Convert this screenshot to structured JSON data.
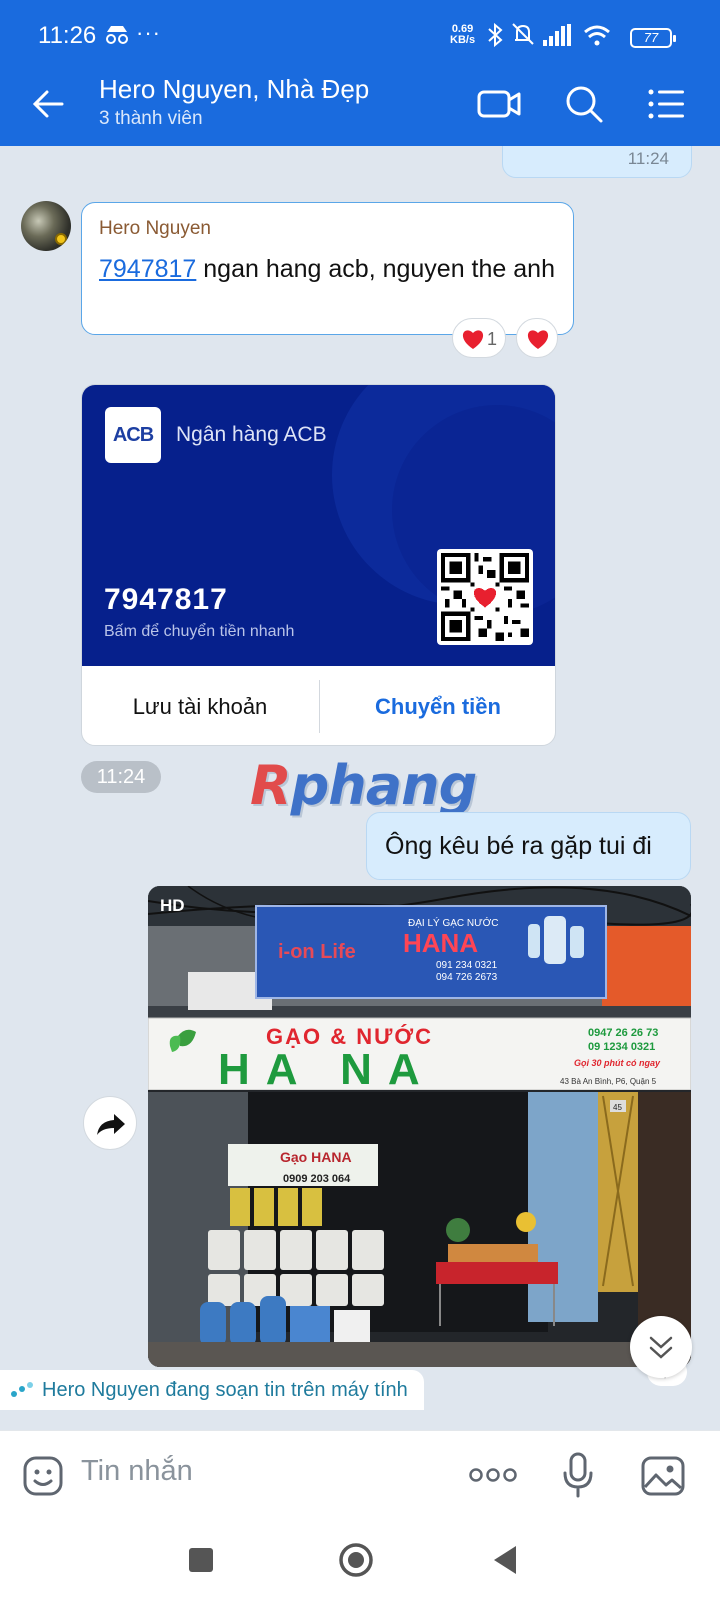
{
  "status_bar": {
    "time": "11:26",
    "more": "···",
    "net_speed_value": "0.69",
    "net_speed_unit": "KB/s",
    "battery": "77"
  },
  "header": {
    "title": "Hero Nguyen, Nhà Đẹp",
    "subtitle": "3 thành viên"
  },
  "chat": {
    "prev_outgoing_time": "11:24",
    "incoming_message": {
      "sender": "Hero Nguyen",
      "account_link": "7947817",
      "text": " ngan hang acb, nguyen the anh",
      "reaction_count": "1"
    },
    "bank_card": {
      "bank_logo": "ACB",
      "bank_name": "Ngân hàng ACB",
      "account_number": "7947817",
      "hint": "Bấm để chuyển tiền nhanh",
      "save_label": "Lưu tài khoản",
      "transfer_label": "Chuyển tiền"
    },
    "card_time": "11:24",
    "watermark_r": "R",
    "watermark_rest": "phang",
    "outgoing_message": "Ông kêu bé ra gặp tui đi",
    "photo": {
      "quality_badge": "HD",
      "banner_brand": "i-on Life",
      "banner_name": "HANA",
      "banner_agency": "ĐẠI LÝ GẠC NƯỚC",
      "banner_phone1": "091 234 0321",
      "banner_phone2": "094 726 2673",
      "sign_top": "GẠO & NƯỚC",
      "sign_main": "HA NA",
      "sign_phone1": "0947 26 26 73",
      "sign_phone2": "09 1234 0321",
      "sign_delivery": "Gọi 30 phút có ngay",
      "sign_address": "43 Bà An Bình, P6, Quận 5",
      "poster_title": "Gạo HANA",
      "poster_phone": "0909 203 064",
      "door_number": "45"
    },
    "typing_indicator": "Hero Nguyen đang soạn tin trên máy tính"
  },
  "composer": {
    "placeholder": "Tin nhắn"
  },
  "colors": {
    "header_blue": "#1a6bde",
    "card_navy": "#06208c",
    "outgoing_bubble": "#d7ecfd",
    "link_blue": "#1a6bde",
    "heart_red": "#e8202f"
  }
}
